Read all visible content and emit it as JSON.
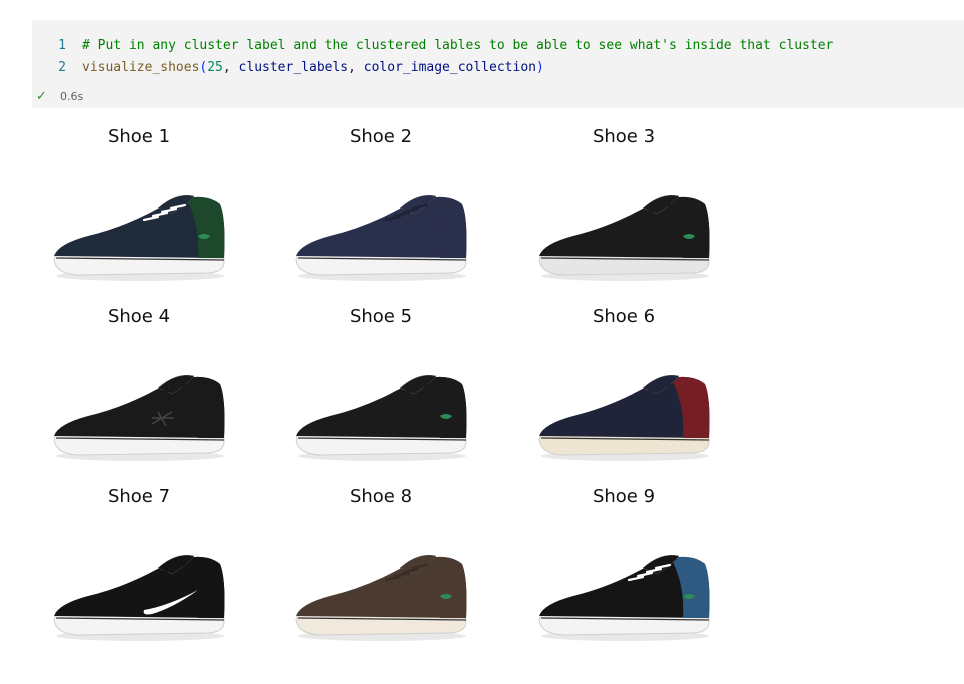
{
  "cell": {
    "lines": [
      {
        "num": "1",
        "comment": "# Put in any cluster label and the clustered lables to be able to see what's inside that cluster"
      },
      {
        "num": "2",
        "fn": "visualize_shoes",
        "open": "(",
        "arg1": "25",
        "sep1": ", ",
        "arg2": "cluster_labels",
        "sep2": ", ",
        "arg3": "color_image_collection",
        "close": ")"
      }
    ],
    "status_icon": "check-icon",
    "exec_time": "0.6s",
    "colors": {
      "check": "#388a34",
      "comment": "#008000",
      "number": "#098658"
    }
  },
  "output": {
    "shoes": [
      {
        "title": "Shoe 1",
        "upper": "#1f2a3a",
        "accent": "#1f4a2a",
        "sole": "#f4f4f4",
        "laces": "#ffffff",
        "logo": "crocodile"
      },
      {
        "title": "Shoe 2",
        "upper": "#2a2f4c",
        "accent": "#2a2f4c",
        "sole": "#f4f4f4",
        "laces": "#1e2235",
        "logo": "none"
      },
      {
        "title": "Shoe 3",
        "upper": "#1b1b1b",
        "accent": "#1b1b1b",
        "sole": "#e6e6e6",
        "laces": "#1b1b1b",
        "logo": "crocodile"
      },
      {
        "title": "Shoe 4",
        "upper": "#1a1a1a",
        "accent": "#1a1a1a",
        "sole": "#f4f4f4",
        "laces": "#1a1a1a",
        "logo": "star-chevron"
      },
      {
        "title": "Shoe 5",
        "upper": "#1b1b1b",
        "accent": "#1b1b1b",
        "sole": "#f4f4f4",
        "laces": "#1b1b1b",
        "logo": "crocodile"
      },
      {
        "title": "Shoe 6",
        "upper": "#1f2438",
        "accent": "#7a1f24",
        "sole": "#eee6d3",
        "laces": "#1f2438",
        "logo": "none"
      },
      {
        "title": "Shoe 7",
        "upper": "#141414",
        "accent": "#141414",
        "sole": "#f4f4f4",
        "laces": "#141414",
        "logo": "swoosh"
      },
      {
        "title": "Shoe 8",
        "upper": "#4a3a30",
        "accent": "#4a3a30",
        "sole": "#f1e9dc",
        "laces": "#3a2d25",
        "logo": "crocodile"
      },
      {
        "title": "Shoe 9",
        "upper": "#151515",
        "accent": "#2f5d86",
        "sole": "#f4f4f4",
        "laces": "#ffffff",
        "logo": "crocodile"
      }
    ]
  }
}
